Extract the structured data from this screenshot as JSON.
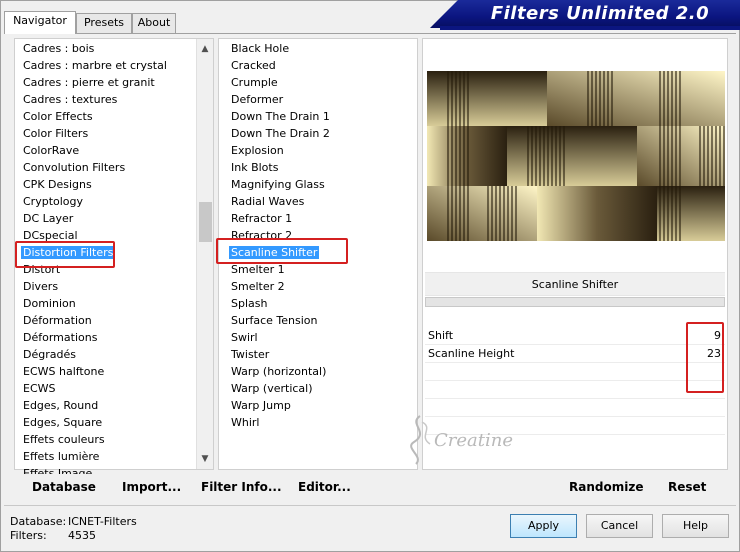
{
  "tabs": [
    {
      "label": "Navigator",
      "active": true
    },
    {
      "label": "Presets",
      "active": false
    },
    {
      "label": "About",
      "active": false
    }
  ],
  "title": "Filters Unlimited 2.0",
  "categories": [
    "Cadres : bois",
    "Cadres : marbre et crystal",
    "Cadres : pierre et granit",
    "Cadres : textures",
    "Color Effects",
    "Color Filters",
    "ColorRave",
    "Convolution Filters",
    "CPK Designs",
    "Cryptology",
    "DC Layer",
    "DCspecial",
    "Distortion Filters",
    "Distort",
    "Divers",
    "Dominion",
    "Déformation",
    "Déformations",
    "Dégradés",
    "ECWS halftone",
    "ECWS",
    "Edges, Round",
    "Edges, Square",
    "Effets couleurs",
    "Effets lumière",
    "Effets Image"
  ],
  "selected_category": "Distortion Filters",
  "filters": [
    "Black Hole",
    "Cracked",
    "Crumple",
    "Deformer",
    "Down The Drain 1",
    "Down The Drain 2",
    "Explosion",
    "Ink Blots",
    "Magnifying Glass",
    "Radial Waves",
    "Refractor 1",
    "Refractor 2",
    "Scanline Shifter",
    "Smelter 1",
    "Smelter 2",
    "Splash",
    "Surface Tension",
    "Swirl",
    "Twister",
    "Warp (horizontal)",
    "Warp (vertical)",
    "Warp Jump",
    "Whirl"
  ],
  "selected_filter": "Scanline Shifter",
  "current_filter_name": "Scanline Shifter",
  "params": [
    {
      "label": "Shift",
      "value": "9"
    },
    {
      "label": "Scanline Height",
      "value": "23"
    }
  ],
  "watermark": "Creatine",
  "bottom_buttons": {
    "database": "Database",
    "import": "Import...",
    "filter_info": "Filter Info...",
    "editor": "Editor...",
    "randomize": "Randomize",
    "reset": "Reset"
  },
  "info": {
    "database_label": "Database:",
    "database_value": "ICNET-Filters",
    "filters_label": "Filters:",
    "filters_value": "4535"
  },
  "dialog_buttons": {
    "apply": "Apply",
    "cancel": "Cancel",
    "help": "Help"
  },
  "colors": {
    "selection": "#3399ff",
    "banner": "#0b1580",
    "annotation": "#d42020"
  }
}
